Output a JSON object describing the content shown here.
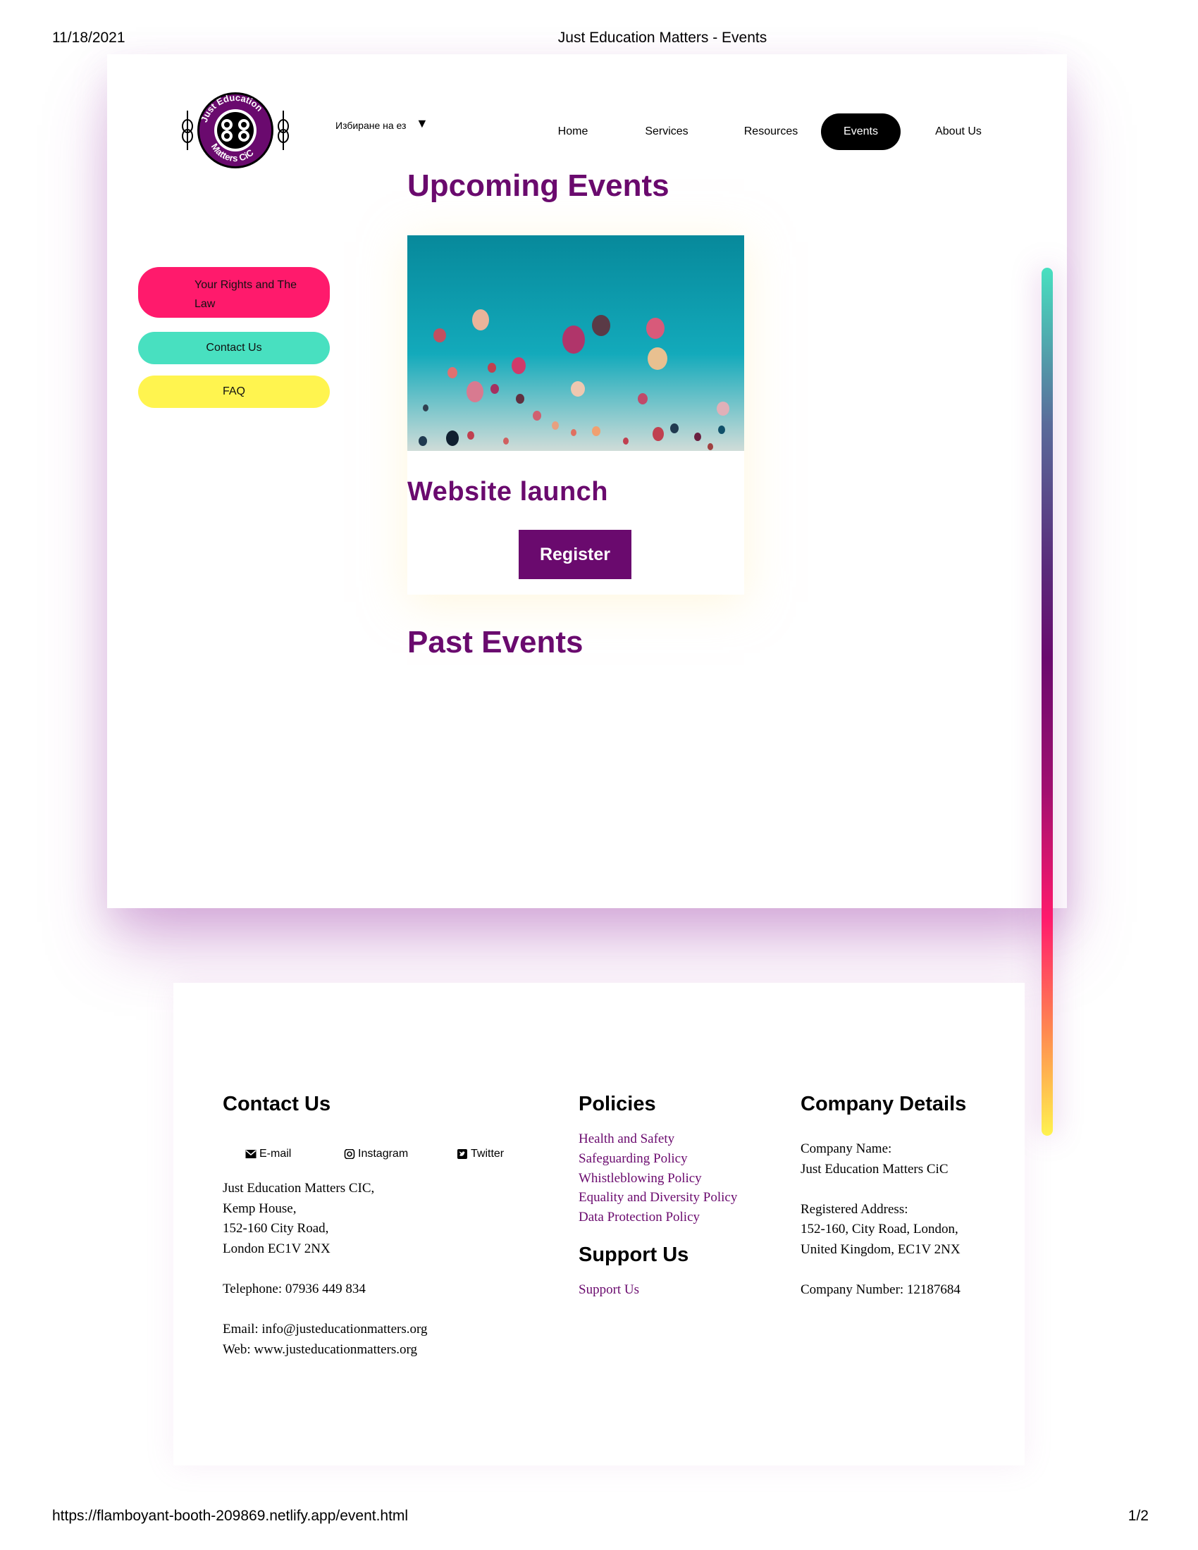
{
  "print": {
    "date": "11/18/2021",
    "title": "Just Education Matters - Events",
    "url": "https://flamboyant-booth-209869.netlify.app/event.html",
    "page": "1/2"
  },
  "header": {
    "logo_text": "Just Education Matters CiC",
    "language_select": "Избиране на ез",
    "language_caret": "▼",
    "nav": [
      "Home",
      "Services",
      "Resources",
      "Events",
      "About Us"
    ],
    "active_nav": "Events"
  },
  "sidebar": {
    "rights_label": "Your Rights and The Law",
    "contact_label": "Contact Us",
    "faq_label": "FAQ"
  },
  "main": {
    "upcoming_heading": "Upcoming Events",
    "event_title": "Website launch",
    "register_label": "Register",
    "past_heading": "Past Events"
  },
  "footer": {
    "contact_heading": "Contact Us",
    "social": [
      "E-mail",
      "Instagram",
      "Twitter"
    ],
    "address_lines": [
      "Just Education Matters CIC,",
      "Kemp House,",
      "152-160 City Road,",
      "London EC1V 2NX",
      "",
      "Telephone: 07936 449 834",
      "",
      "Email: info@justeducationmatters.org",
      "Web: www.justeducationmatters.org"
    ],
    "policies_heading": "Policies",
    "policies": [
      "Health and Safety",
      "Safeguarding Policy",
      "Whistleblowing Policy",
      "Equality and Diversity Policy",
      "Data Protection Policy"
    ],
    "support_heading": "Support Us",
    "support_link": "Support Us",
    "company_heading": "Company Details",
    "company_lines": [
      "Company Name:",
      "Just Education Matters CiC",
      "",
      "Registered Address:",
      "152-160, City Road, London,",
      "United Kingdom, EC1V 2NX",
      "",
      "Company Number: 12187684"
    ]
  },
  "colors": {
    "brand_purple": "#6a0a6e",
    "pink": "#ff1a6c",
    "teal": "#48e0c0",
    "yellow": "#fff44f"
  }
}
